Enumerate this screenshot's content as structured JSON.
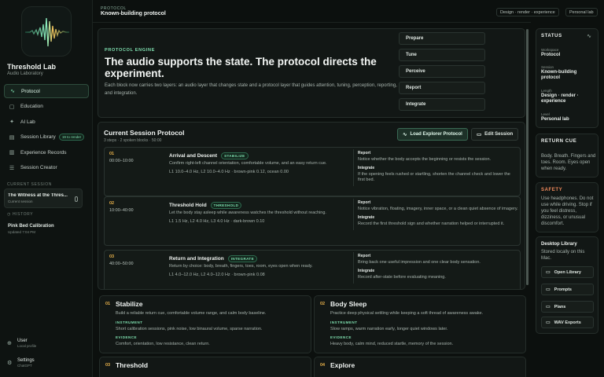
{
  "sidebar": {
    "app_title": "Threshold Lab",
    "app_subtitle": "Audio Laboratory",
    "nav": [
      {
        "label": "Protocol",
        "icon": "pulse-icon",
        "glyph": "∿",
        "active": true,
        "badge": ""
      },
      {
        "label": "Education",
        "icon": "book-icon",
        "glyph": "▢",
        "active": false,
        "badge": ""
      },
      {
        "label": "AI Lab",
        "icon": "sparkle-icon",
        "glyph": "✦",
        "active": false,
        "badge": ""
      },
      {
        "label": "Session Library",
        "icon": "library-icon",
        "glyph": "▤",
        "active": false,
        "badge": "19 to render"
      },
      {
        "label": "Experience Records",
        "icon": "records-icon",
        "glyph": "▥",
        "active": false,
        "badge": ""
      },
      {
        "label": "Session Creator",
        "icon": "creator-icon",
        "glyph": "☰",
        "active": false,
        "badge": ""
      }
    ],
    "current_label": "CURRENT SESSION",
    "current_title": "The Witness at the Thres...",
    "current_sub": "Current session",
    "history_label": "HISTORY",
    "history": [
      {
        "title": "Pink Bed Calibration",
        "sub": "Updated 7:04 PM"
      }
    ],
    "user": {
      "title": "User",
      "sub": "Local profile"
    },
    "settings": {
      "title": "Settings",
      "sub": "ChatGPT"
    }
  },
  "header": {
    "label": "PROTOCOL",
    "title": "Known-building protocol",
    "chips": [
      "Design · render · experience",
      "Personal lab"
    ]
  },
  "hero": {
    "eyebrow": "PROTOCOL ENGINE",
    "title": "The audio supports the state. The protocol directs the experiment.",
    "body": "Each block now carries two layers: an audio layer that changes state and a protocol layer that guides attention, tuning, perception, reporting, and integration.",
    "steps": [
      "Prepare",
      "Tune",
      "Perceive",
      "Report",
      "Integrate"
    ]
  },
  "session": {
    "title": "Current Session Protocol",
    "meta": "3 steps · 2 spoken blocks · 50:00",
    "load_label": "Load Explorer Protocol",
    "edit_label": "Edit Session",
    "blocks": [
      {
        "num": "01",
        "time": "00:00–10:00",
        "name": "Arrival and Descent",
        "tag": "STABILIZE",
        "desc": "Confirm right-left channel orientation, comfortable volume, and an easy return cue.",
        "params": "L1 10.0–4.0 Hz, L2 10.0–4.0 Hz · brown-pink 0.12, ocean 0.00",
        "report_label": "Report",
        "report": "Notice whether the body accepts the beginning or resists the session.",
        "integrate_label": "Integrate",
        "integrate": "If the opening feels rushed or startling, shorten the channel check and lower the first bed."
      },
      {
        "num": "02",
        "time": "10:00–40:00",
        "name": "Threshold Hold",
        "tag": "THRESHOLD",
        "desc": "Let the body stay asleep while awareness watches the threshold without reaching.",
        "params": "L1 1.5 Hz, L2 4.0 Hz, L3 4.0 Hz · dark-brown 0.10",
        "report_label": "Report",
        "report": "Notice vibration, floating, imagery, inner space, or a clean quiet absence of imagery.",
        "integrate_label": "Integrate",
        "integrate": "Record the first threshold sign and whether narration helped or interrupted it."
      },
      {
        "num": "03",
        "time": "40:00–50:00",
        "name": "Return and Integration",
        "tag": "INTEGRATE",
        "desc": "Return by choice: body, breath, fingers, toes, room, eyes open when ready.",
        "params": "L1 4.0–12.0 Hz, L2 4.0–12.0 Hz · brown-pink 0.08",
        "report_label": "Report",
        "report": "Bring back one useful impression and one clear body sensation.",
        "integrate_label": "Integrate",
        "integrate": "Record after-state before evaluating meaning."
      }
    ]
  },
  "cards": [
    {
      "num": "01",
      "title": "Stabilize",
      "desc": "Build a reliable return cue, comfortable volume range, and calm body baseline.",
      "k1": "INSTRUMENT",
      "v1": "Short calibration sessions, pink noise, low binaural volume, sparse narration.",
      "k2": "EVIDENCE",
      "v2": "Comfort, orientation, low resistance, clean return."
    },
    {
      "num": "02",
      "title": "Body Sleep",
      "desc": "Practice deep physical settling while keeping a soft thread of awareness awake.",
      "k1": "INSTRUMENT",
      "v1": "Slow ramps, warm narration early, longer quiet windows later.",
      "k2": "EVIDENCE",
      "v2": "Heavy body, calm mind, reduced startle, memory of the session."
    },
    {
      "num": "03",
      "title": "Threshold",
      "desc": "",
      "k1": "",
      "v1": "",
      "k2": "",
      "v2": ""
    },
    {
      "num": "04",
      "title": "Explore",
      "desc": "",
      "k1": "",
      "v1": "",
      "k2": "",
      "v2": ""
    }
  ],
  "rail": {
    "status_label": "STATUS",
    "status": [
      {
        "k": "Workspace",
        "v": "Protocol"
      },
      {
        "k": "Session",
        "v": "Known-building protocol"
      },
      {
        "k": "Length",
        "v": "Design · render · experience"
      },
      {
        "k": "Level",
        "v": "Personal lab"
      }
    ],
    "return_label": "RETURN CUE",
    "return_text": "Body. Breath. Fingers and toes. Room. Eyes open when ready.",
    "safety_label": "SAFETY",
    "safety_text": "Use headphones. Do not use while driving. Stop if you feel distress, dizziness, or unusual discomfort.",
    "desktop_title": "Desktop Library",
    "desktop_sub": "Stored locally on this Mac.",
    "buttons": [
      "Open Library",
      "Prompts",
      "Plans",
      "WAV Exports"
    ]
  },
  "colors": {
    "accent": "#7fe0b0",
    "number": "#e8b14a",
    "safety": "#f08a5b",
    "background": "#0c100e"
  }
}
